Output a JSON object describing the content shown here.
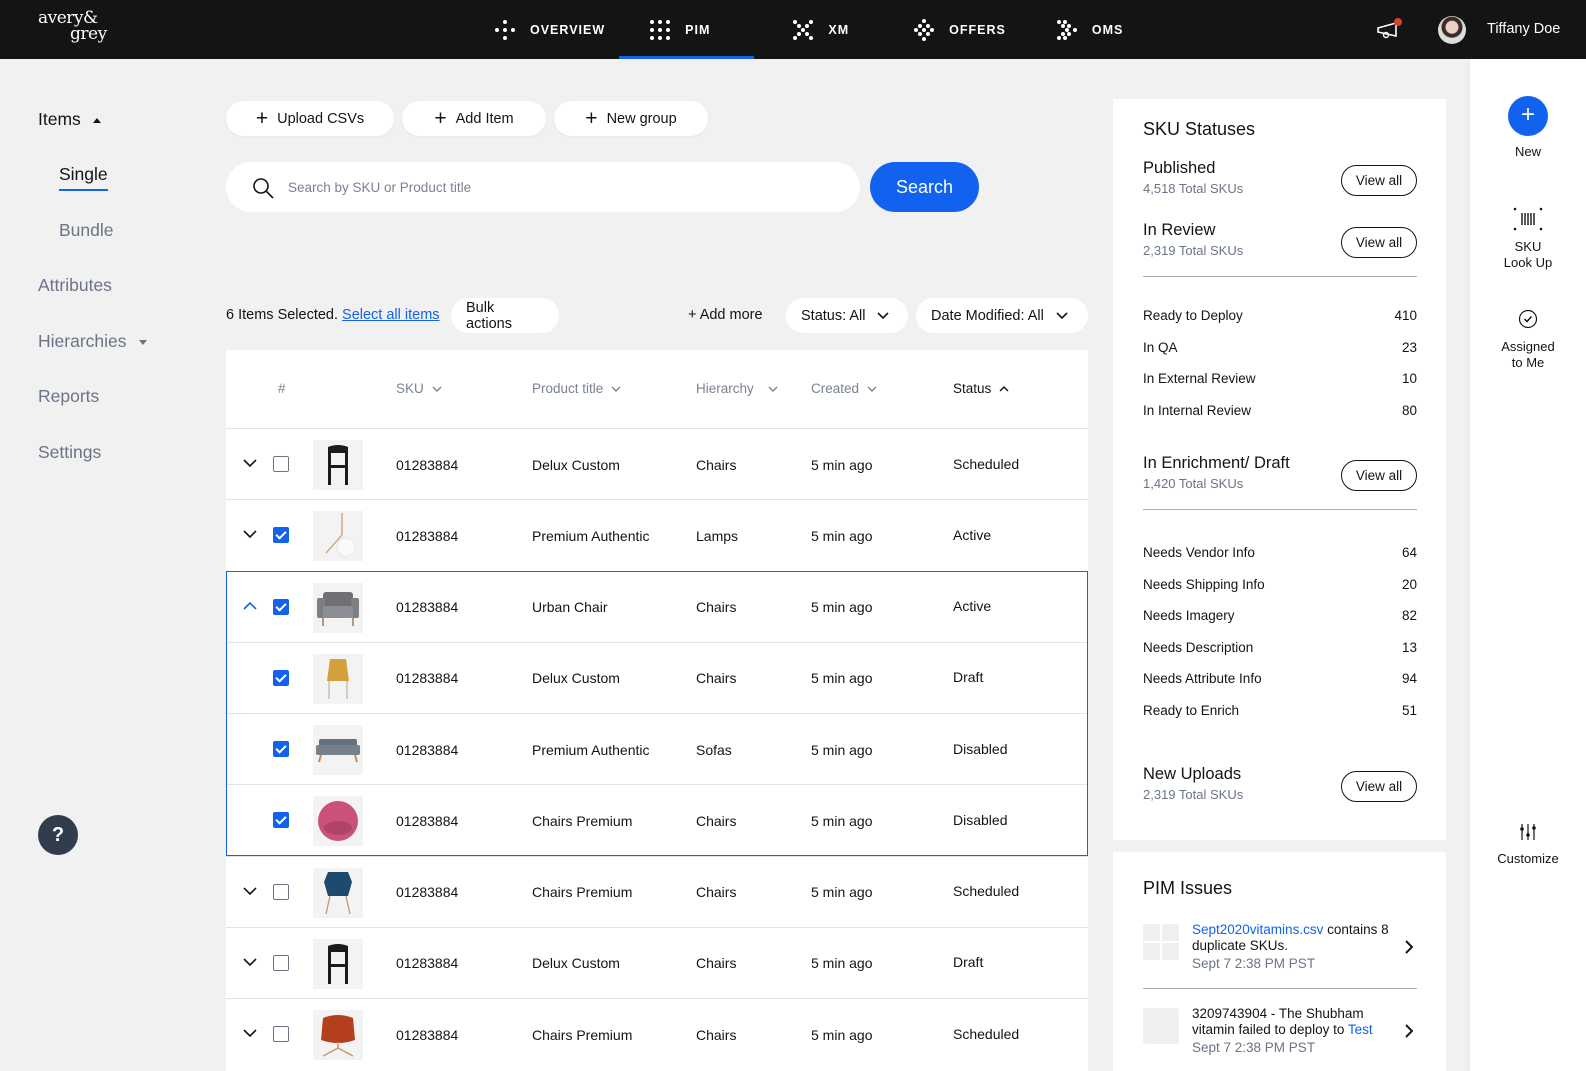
{
  "brand": {
    "line1": "avery&",
    "line2": "grey"
  },
  "nav": {
    "items": [
      {
        "label": "OVERVIEW",
        "icon": "overview-dots-icon",
        "active": false
      },
      {
        "label": "PIM",
        "icon": "pim-grid-icon",
        "active": true
      },
      {
        "label": "XM",
        "icon": "xm-cross-icon",
        "active": false
      },
      {
        "label": "OFFERS",
        "icon": "offers-diamond-icon",
        "active": false
      },
      {
        "label": "OMS",
        "icon": "oms-arrow-icon",
        "active": false
      }
    ],
    "accent": "#1262f0"
  },
  "user": {
    "name": "Tiffany Doe",
    "has_notification": true
  },
  "sidebar": {
    "items": "Items",
    "single": "Single",
    "bundle": "Bundle",
    "attributes": "Attributes",
    "hierarchies": "Hierarchies",
    "reports": "Reports",
    "settings": "Settings",
    "help": "?"
  },
  "toolbar": {
    "upload_csvs": "Upload CSVs",
    "add_item": "Add Item",
    "new_group": "New group",
    "search_placeholder": "Search by SKU or Product title",
    "search_value": "",
    "search_button": "Search"
  },
  "selection": {
    "text": "6 Items Selected.",
    "select_all": "Select all items",
    "bulk_actions": "Bulk actions",
    "add_more": "+ Add more",
    "status_filter": "Status: All",
    "date_filter": "Date Modified: All"
  },
  "table": {
    "headers": {
      "num": "#",
      "sku": "SKU",
      "title": "Product title",
      "hierarchy": "Hierarchy",
      "created": "Created",
      "status": "Status"
    },
    "rows": [
      {
        "sku": "01283884",
        "title": "Delux Custom",
        "hierarchy": "Chairs",
        "created": "5 min ago",
        "status": "Scheduled",
        "checked": false,
        "expander": "down",
        "thumb": "black-chair"
      },
      {
        "sku": "01283884",
        "title": "Premium Authentic",
        "hierarchy": "Lamps",
        "created": "5 min ago",
        "status": "Active",
        "checked": true,
        "expander": "down",
        "thumb": "lamp"
      },
      {
        "sku": "01283884",
        "title": "Urban Chair",
        "hierarchy": "Chairs",
        "created": "5 min ago",
        "status": "Active",
        "checked": true,
        "expander": "up",
        "thumb": "grey-armchair"
      },
      {
        "sku": "01283884",
        "title": "Delux Custom",
        "hierarchy": "Chairs",
        "created": "5 min ago",
        "status": "Draft",
        "checked": true,
        "expander": "none",
        "thumb": "yellow-chair"
      },
      {
        "sku": "01283884",
        "title": "Premium Authentic",
        "hierarchy": "Sofas",
        "created": "5 min ago",
        "status": "Disabled",
        "checked": true,
        "expander": "none",
        "thumb": "grey-sofa"
      },
      {
        "sku": "01283884",
        "title": "Chairs Premium",
        "hierarchy": "Chairs",
        "created": "5 min ago",
        "status": "Disabled",
        "checked": true,
        "expander": "none",
        "thumb": "pink-chair"
      },
      {
        "sku": "01283884",
        "title": "Chairs Premium",
        "hierarchy": "Chairs",
        "created": "5 min ago",
        "status": "Scheduled",
        "checked": false,
        "expander": "down",
        "thumb": "blue-chair"
      },
      {
        "sku": "01283884",
        "title": "Delux Custom",
        "hierarchy": "Chairs",
        "created": "5 min ago",
        "status": "Draft",
        "checked": false,
        "expander": "down",
        "thumb": "black-chair"
      },
      {
        "sku": "01283884",
        "title": "Chairs Premium",
        "hierarchy": "Chairs",
        "created": "5 min ago",
        "status": "Scheduled",
        "checked": false,
        "expander": "down",
        "thumb": "red-swivel-chair"
      }
    ]
  },
  "sku_statuses": {
    "title": "SKU Statuses",
    "view_all": "View all",
    "published": {
      "label": "Published",
      "total": "4,518 Total SKUs"
    },
    "in_review": {
      "label": "In Review",
      "total": "2,319 Total SKUs"
    },
    "review_rows": [
      {
        "label": "Ready to Deploy",
        "value": "410"
      },
      {
        "label": "In QA",
        "value": "23"
      },
      {
        "label": "In External Review",
        "value": "10"
      },
      {
        "label": "In Internal Review",
        "value": "80"
      }
    ],
    "enrichment": {
      "label": "In Enrichment/ Draft",
      "total": "1,420 Total SKUs"
    },
    "enrichment_rows": [
      {
        "label": "Needs Vendor Info",
        "value": "64"
      },
      {
        "label": "Needs Shipping Info",
        "value": "20"
      },
      {
        "label": "Needs Imagery",
        "value": "82"
      },
      {
        "label": "Needs Description",
        "value": "13"
      },
      {
        "label": "Needs Attribute Info",
        "value": "94"
      },
      {
        "label": "Ready to Enrich",
        "value": "51"
      }
    ],
    "new_uploads": {
      "label": "New Uploads",
      "total": "2,319 Total SKUs"
    }
  },
  "pim_issues": {
    "title": "PIM Issues",
    "items": [
      {
        "link": "Sept2020vitamins.csv",
        "text": " contains 8 duplicate SKUs.",
        "time": "Sept 7 2:38 PM PST"
      },
      {
        "text": "3209743904 - The Shubham vitamin failed to deploy to ",
        "link": "Test",
        "time": "Sept 7 2:38 PM PST"
      }
    ]
  },
  "rail": {
    "new": "New",
    "sku_lookup_1": "SKU",
    "sku_lookup_2": "Look Up",
    "assigned_1": "Assigned",
    "assigned_2": "to Me",
    "customize": "Customize"
  }
}
